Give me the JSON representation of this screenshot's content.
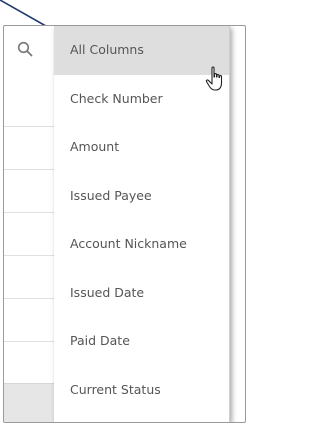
{
  "column_filter_menu": {
    "items": [
      {
        "label": "All Columns",
        "selected": true
      },
      {
        "label": "Check Number",
        "selected": false
      },
      {
        "label": "Amount",
        "selected": false
      },
      {
        "label": "Issued Payee",
        "selected": false
      },
      {
        "label": "Account Nickname",
        "selected": false
      },
      {
        "label": "Issued Date",
        "selected": false
      },
      {
        "label": "Paid Date",
        "selected": false
      },
      {
        "label": "Current Status",
        "selected": false
      }
    ]
  },
  "icons": {
    "search": "search-icon",
    "pointer": "hand-pointer-icon",
    "annotation": "callout-arrow"
  },
  "colors": {
    "selected_item_bg": "#dedede",
    "item_text": "#555555",
    "arrow": "#1f3a6e"
  }
}
